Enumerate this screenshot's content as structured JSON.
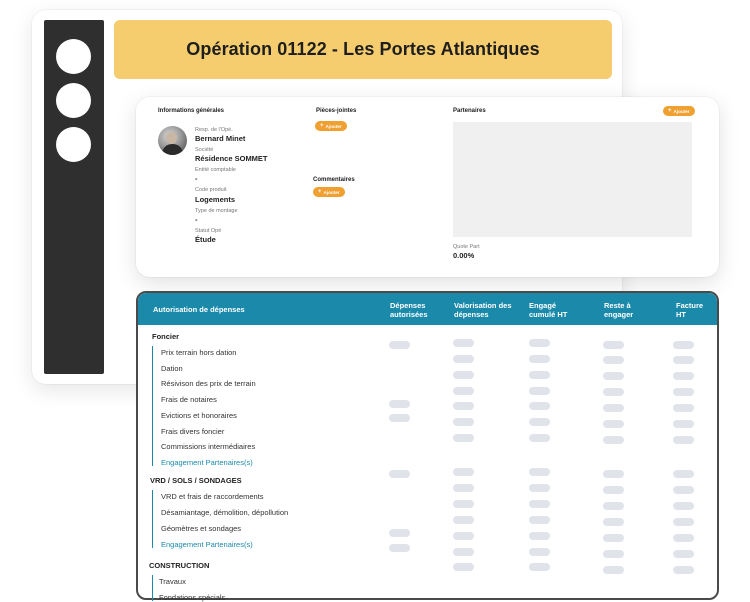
{
  "operation": {
    "title": "Opération 01122 - Les Portes Atlantiques"
  },
  "sidebar": {
    "items": [
      "circle",
      "circle",
      "circle"
    ]
  },
  "info": {
    "general_title": "Informations générales",
    "fields": [
      {
        "label": "Resp. de l'Opé.",
        "value": "Bernard Minet"
      },
      {
        "label": "Société",
        "value": "Résidence SOMMET"
      },
      {
        "label": "Entité comptable",
        "value": "-"
      },
      {
        "label": "Code produit",
        "value": "Logements"
      },
      {
        "label": "Type de montage",
        "value": "-"
      },
      {
        "label": "Statut Opé",
        "value": "Étude"
      }
    ],
    "attachments_title": "Pièces-jointes",
    "comments_title": "Commentaires",
    "partners_title": "Partenaires",
    "add_label": "Ajouter",
    "quote_part_label": "Quote Part",
    "quote_part_value": "0.00%"
  },
  "table": {
    "headers": [
      "Autorisation de dépenses",
      "Dépenses autorisées",
      "Valorisation des dépenses",
      "Engagé cumulé HT",
      "Reste à engager",
      "Facture HT"
    ],
    "groups": [
      {
        "name": "Foncier",
        "rows": [
          "Prix terrain hors dation",
          "Dation",
          "Résivison des prix de terrain",
          "Frais de notaires",
          "Evictions et honoraires",
          "Frais divers foncier",
          "Commissions intermédiaires",
          "Engagement Partenaires(s)"
        ]
      },
      {
        "name": "VRD / SOLS / SONDAGES",
        "rows": [
          "VRD et frais de raccordements",
          "Désamiantage, démolition, dépollution",
          "Géomètres et sondages",
          "Engagement Partenaires(s)"
        ]
      },
      {
        "name": "CONSTRUCTION",
        "rows": [
          "Travaux",
          "Fondations spécials"
        ]
      }
    ]
  },
  "colors": {
    "accent": "#1b8aaa",
    "banner": "#f6cd6e",
    "button": "#f0a030",
    "sidebar": "#2f2f2f"
  }
}
